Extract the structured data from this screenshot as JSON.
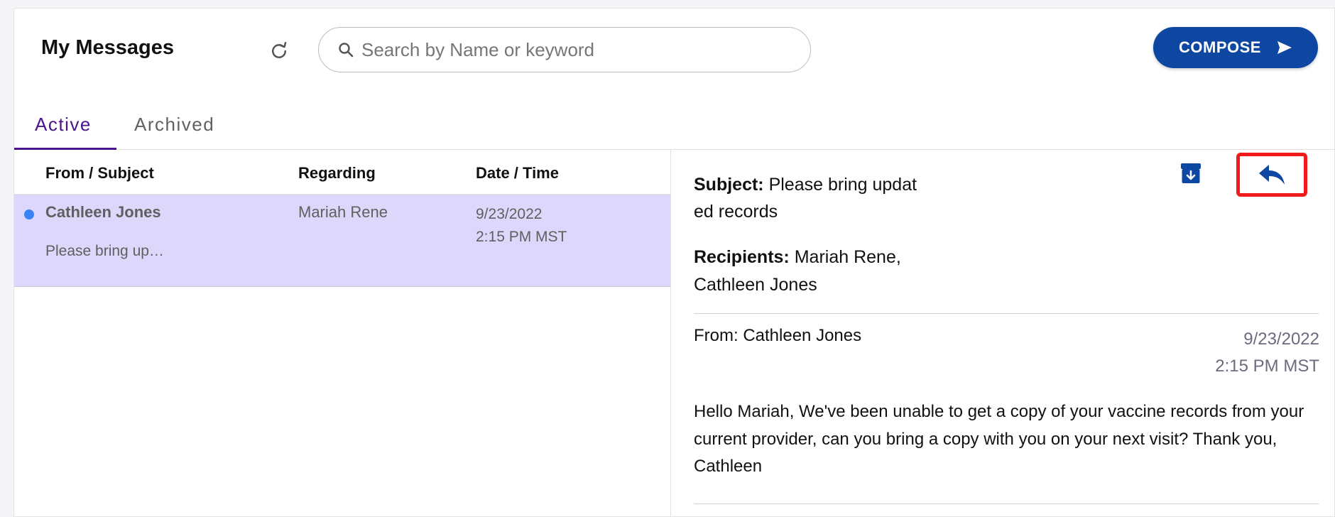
{
  "header": {
    "title": "My Messages",
    "search_placeholder": "Search by Name or keyword",
    "compose_label": "COMPOSE"
  },
  "tabs": [
    {
      "label": "Active",
      "active": true
    },
    {
      "label": "Archived",
      "active": false
    }
  ],
  "list": {
    "columns": [
      "From / Subject",
      "Regarding",
      "Date / Time"
    ],
    "rows": [
      {
        "from": "Cathleen Jones",
        "snippet": "Please bring up…",
        "regarding": "Mariah Rene",
        "date": "9/23/2022",
        "time": "2:15 PM MST",
        "unread": true,
        "selected": true
      }
    ]
  },
  "detail": {
    "subject_label": "Subject:",
    "subject": "Please bring updat ed records",
    "recipients_label": "Recipients:",
    "recipients": "Mariah Rene, Cathleen Jones",
    "from": "From: Cathleen Jones",
    "date": "9/23/2022",
    "time": "2:15 PM MST",
    "body": "Hello Mariah, We've been unable to get a copy of your vaccine records from your current provider, can you bring a copy with you on your next visit? Thank you, Cathleen"
  },
  "colors": {
    "accent": "#4a148c",
    "compose_bg": "#0d47a1",
    "selected_row": "#ddd8fb",
    "unread_dot": "#3b82f6",
    "highlight_box": "#ef1b1b"
  },
  "icons": {
    "refresh": "refresh-icon",
    "search": "search-icon",
    "send": "send-icon",
    "archive": "archive-icon",
    "reply": "reply-icon"
  }
}
